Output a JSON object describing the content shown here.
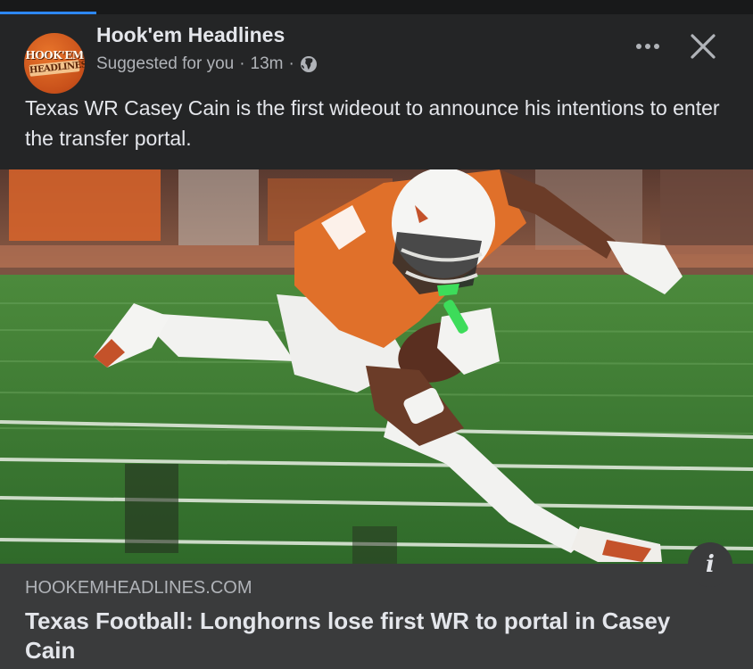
{
  "post": {
    "page_name": "Hook'em Headlines",
    "avatar_text_top": "HOOK'EM",
    "avatar_text_bottom": "HEADLINES",
    "suggested": "Suggested for you",
    "separator": "·",
    "time": "13m",
    "audience_icon": "globe-icon",
    "text": "Texas WR Casey Cain is the first wideout to announce his intentions to enter the transfer portal."
  },
  "actions": {
    "more_icon": "more-horizontal-icon",
    "close_icon": "close-icon",
    "info_glyph": "i"
  },
  "link": {
    "domain": "HOOKEMHEADLINES.COM",
    "title": "Texas Football: Longhorns lose first WR to portal in Casey Cain"
  },
  "colors": {
    "background": "#242526",
    "link_card": "#3a3b3c",
    "accent_progress": "#2d88ff",
    "jersey_orange": "#e0702a",
    "field_green": "#3f7a34"
  }
}
